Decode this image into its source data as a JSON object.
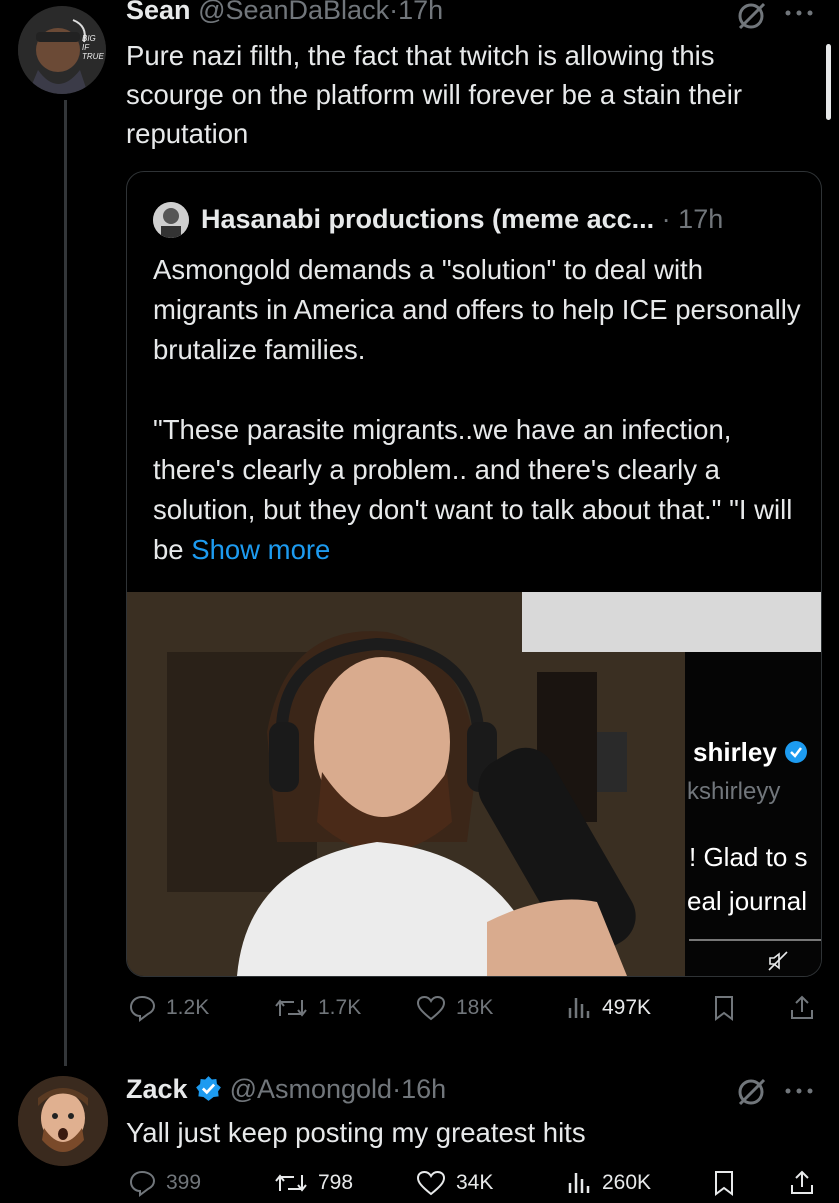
{
  "thread": {
    "post1": {
      "display_name": "Sean",
      "handle": "@SeanDaBlack",
      "separator": "·",
      "time": "17h",
      "avatar_text": "BIG IF TRUE",
      "text": "Pure nazi filth, the fact that twitch is allowing this scourge on the platform will forever be a stain their reputation",
      "quote": {
        "display_name": "Hasanabi productions (meme acc...",
        "separator": "·",
        "time": "17h",
        "text": "Asmongold demands a \"solution\" to deal with migrants in America and offers to help ICE personally brutalize families.\n\n\"These parasite migrants..we have an infection, there's clearly a problem.. and there's clearly a solution, but they don't want to talk about that.\" \"I will be ",
        "show_more": "Show more",
        "media": {
          "overlay_name": "shirley",
          "overlay_handle": "kshirleyy",
          "overlay_line1": "! Glad to s",
          "overlay_line2": "eal journal"
        }
      },
      "stats": {
        "replies": "1.2K",
        "reposts": "1.7K",
        "likes": "18K",
        "views": "497K"
      }
    },
    "post2": {
      "display_name": "Zack",
      "handle": "@Asmongold",
      "separator": "·",
      "time": "16h",
      "text": "Yall just keep posting my greatest hits",
      "stats": {
        "replies": "399",
        "reposts": "798",
        "likes": "34K",
        "views": "260K"
      }
    }
  },
  "icons": [
    "grok-icon",
    "more-icon",
    "reply-icon",
    "repost-icon",
    "like-icon",
    "views-icon",
    "bookmark-icon",
    "share-icon",
    "verified-badge-icon",
    "mute-icon"
  ],
  "colors": {
    "background": "#000000",
    "text": "#e7e9ea",
    "muted": "#71767b",
    "link": "#1d9bf0",
    "verified": "#1d9bf0",
    "border": "#2f3336"
  }
}
